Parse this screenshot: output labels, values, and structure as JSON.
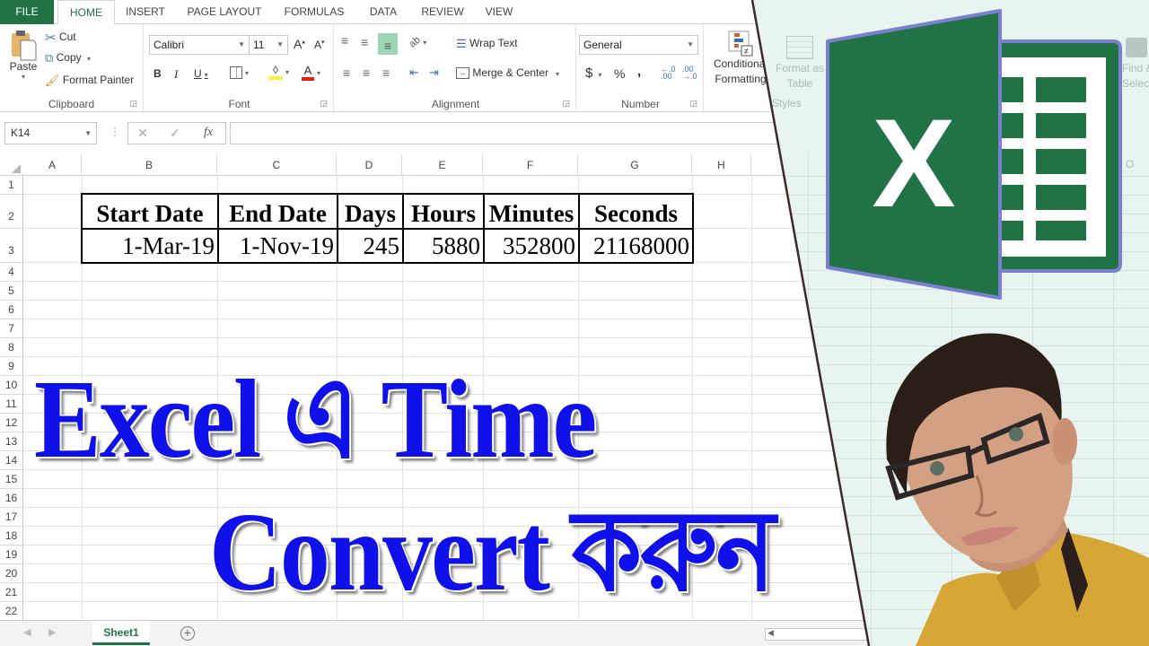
{
  "ribbon": {
    "tabs": [
      {
        "label": "FILE"
      },
      {
        "label": "HOME",
        "active": true
      },
      {
        "label": "INSERT"
      },
      {
        "label": "PAGE LAYOUT"
      },
      {
        "label": "FORMULAS"
      },
      {
        "label": "DATA"
      },
      {
        "label": "REVIEW"
      },
      {
        "label": "VIEW"
      }
    ],
    "clipboard": {
      "group_label": "Clipboard",
      "paste_label": "Paste",
      "cut_label": "Cut",
      "copy_label": "Copy",
      "format_painter_label": "Format Painter"
    },
    "font": {
      "group_label": "Font",
      "font_name": "Calibri",
      "font_size": "11",
      "bold": "B",
      "italic": "I",
      "underline": "U"
    },
    "alignment": {
      "group_label": "Alignment",
      "wrap_text_label": "Wrap Text",
      "merge_center_label": "Merge & Center"
    },
    "number": {
      "group_label": "Number",
      "format": "General",
      "currency": "$",
      "percent": "%",
      "comma": ","
    },
    "styles": {
      "group_label": "Styles",
      "conditional_formatting_line1": "Conditional",
      "conditional_formatting_line2": "Formatting",
      "format_as_table_line1": "Format as",
      "format_as_table_line2": "Table"
    },
    "editing": {
      "find_select_line1": "Find &",
      "find_select_line2": "Select"
    }
  },
  "formula_bar": {
    "name_box": "K14",
    "cancel": "✕",
    "enter": "✓",
    "fx": "fx",
    "value": ""
  },
  "grid": {
    "columns": [
      "A",
      "B",
      "C",
      "D",
      "E",
      "F",
      "G",
      "H",
      "O"
    ],
    "rows": [
      "1",
      "2",
      "3",
      "4",
      "5",
      "6",
      "7",
      "8",
      "9",
      "10",
      "11",
      "12",
      "13",
      "14",
      "15",
      "16",
      "17",
      "18",
      "19",
      "20",
      "21",
      "22"
    ]
  },
  "table": {
    "headers": [
      "Start Date",
      "End Date",
      "Days",
      "Hours",
      "Minutes",
      "Seconds"
    ],
    "values": [
      "1-Mar-19",
      "1-Nov-19",
      "245",
      "5880",
      "352800",
      "21168000"
    ]
  },
  "overlay": {
    "line1": "Excel এ Time",
    "line2": "Convert করুন",
    "color": "#1010e8"
  },
  "logo": {
    "letter": "X",
    "brand_color": "#217346"
  },
  "sheets": {
    "tabs": [
      {
        "label": "Sheet1",
        "active": true
      }
    ],
    "add_label": "+"
  }
}
